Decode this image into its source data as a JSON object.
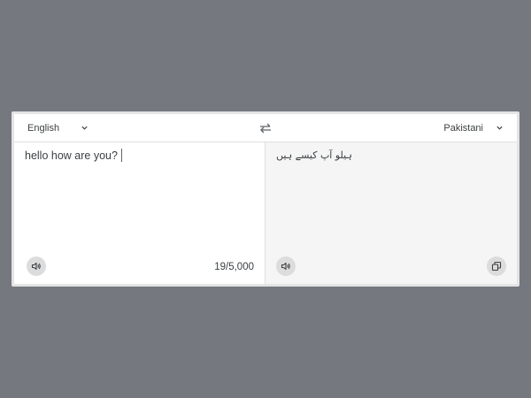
{
  "source_language": {
    "label": "English",
    "icon": "chevron-down-icon"
  },
  "target_language": {
    "label": "Pakistani",
    "icon": "chevron-down-icon"
  },
  "swap": {
    "icon": "swap-arrows-icon"
  },
  "source_panel": {
    "text": "hello how are you?",
    "char_count": "19/5,000",
    "speak_icon": "speaker-icon"
  },
  "target_panel": {
    "text": "ہیلو آپ کیسے ہیں",
    "speak_icon": "speaker-icon",
    "copy_icon": "copy-icon"
  },
  "colors": {
    "backdrop": "#75787f",
    "card": "#ffffff",
    "target_pane": "#f5f5f5",
    "button_bg": "#dcdcdc",
    "text": "#3c4043"
  }
}
